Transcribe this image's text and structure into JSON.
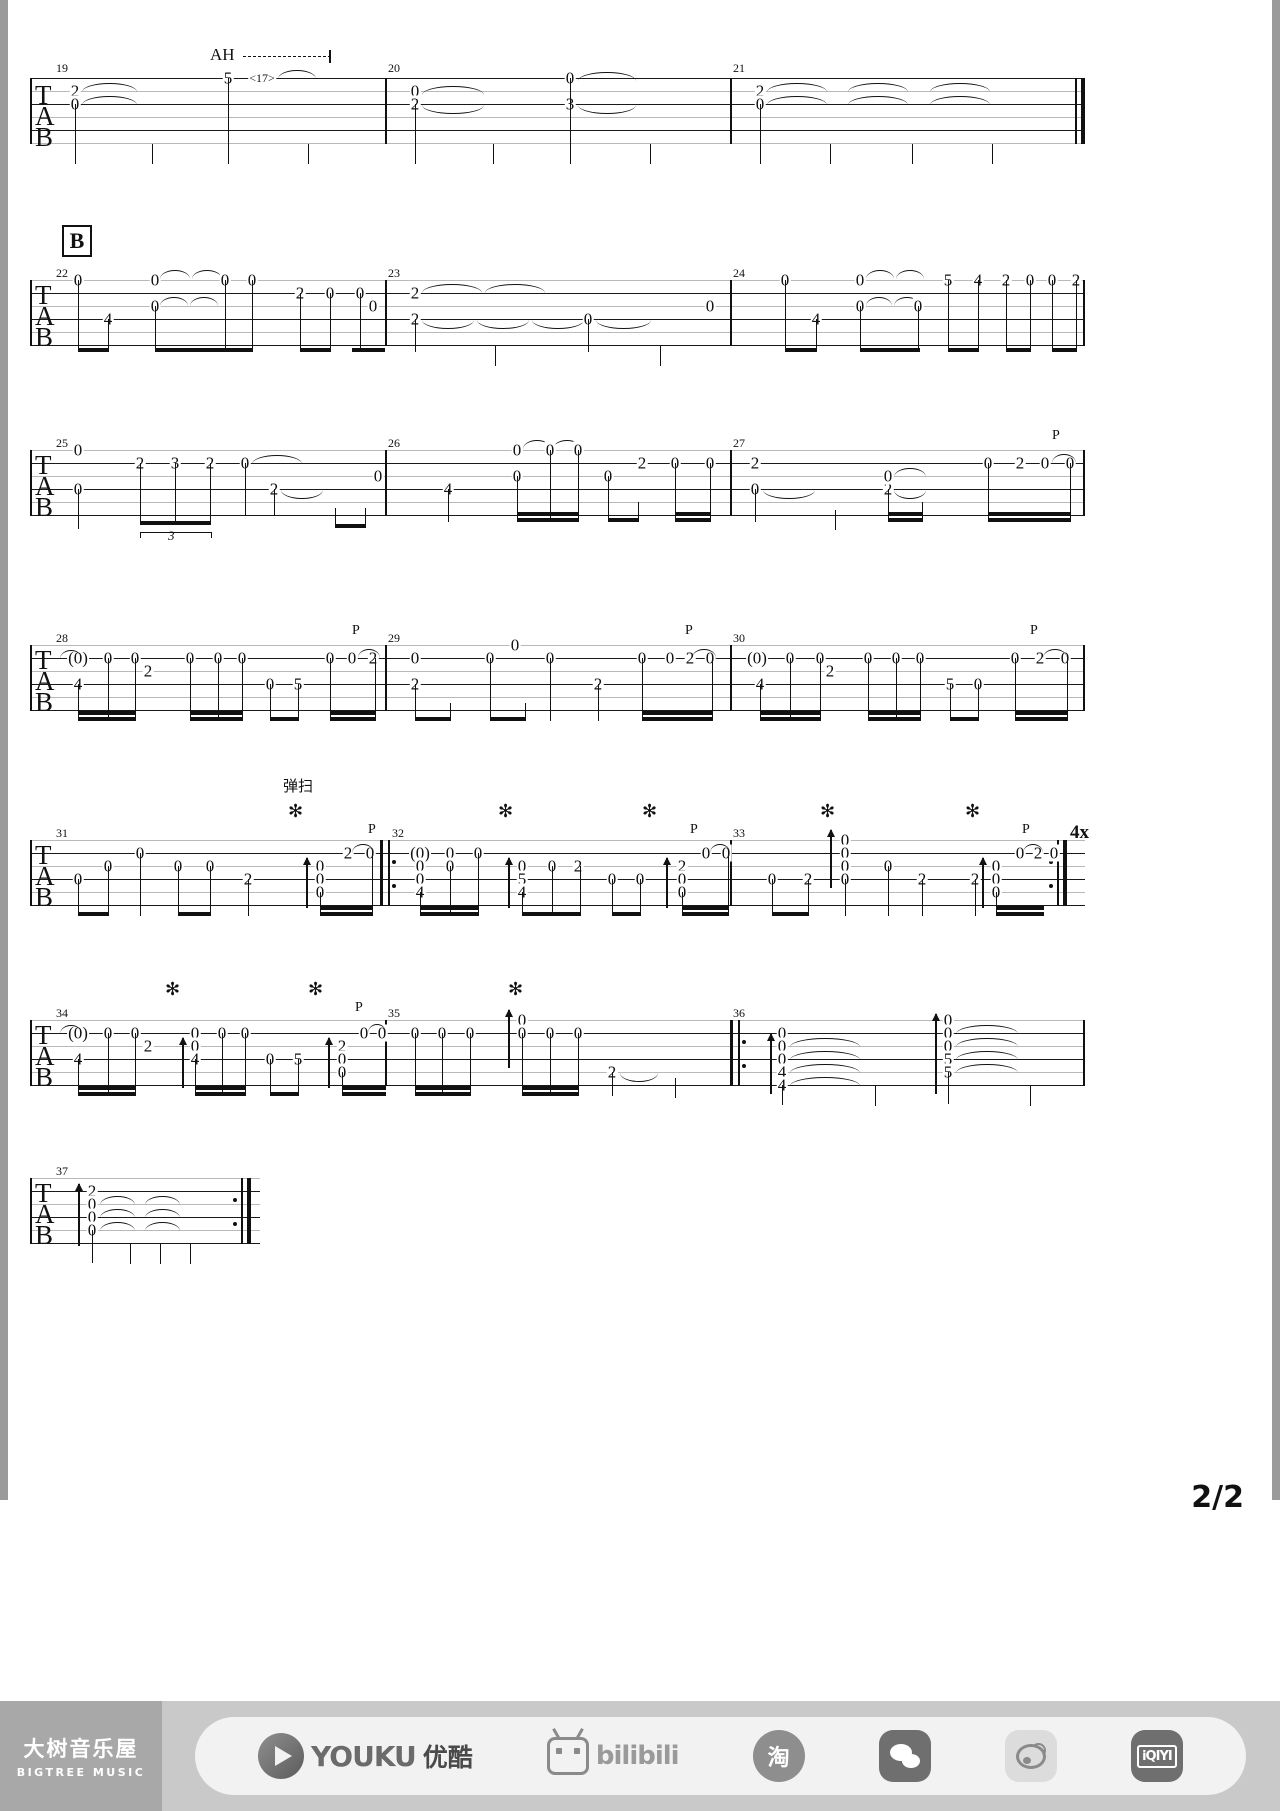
{
  "document": {
    "type": "guitar-tablature",
    "page_label": "2/2",
    "string_labels": [
      "T",
      "A",
      "B"
    ],
    "section_marker": "B",
    "annotations": {
      "artificial_harmonic": "AH",
      "strum_cn": "弹扫",
      "pull_off": "P",
      "repeat_times": "4x",
      "triplet": "3",
      "harmonic_fret": "<17>",
      "asterisk": "✻"
    }
  },
  "systems": [
    {
      "id": "system-1",
      "measures": [
        "19",
        "20",
        "21"
      ],
      "notes_m19": [
        "2",
        "0",
        "5",
        "<17>"
      ],
      "notes_m20": [
        "0",
        "2",
        "0",
        "3"
      ],
      "notes_m21": [
        "2",
        "0"
      ]
    },
    {
      "id": "system-2",
      "measures": [
        "22",
        "23",
        "24"
      ],
      "notes_m22": [
        "0",
        "4",
        "0",
        "0",
        "0",
        "0",
        "2",
        "0",
        "0",
        "0"
      ],
      "notes_m23": [
        "2",
        "0",
        "0",
        "2",
        "0"
      ],
      "notes_m24": [
        "0",
        "4",
        "0",
        "0",
        "0",
        "5",
        "4",
        "2",
        "0",
        "0",
        "2"
      ]
    },
    {
      "id": "system-3",
      "measures": [
        "25",
        "26",
        "27"
      ],
      "notes_m25": [
        "0",
        "0",
        "2",
        "3",
        "2",
        "0",
        "2",
        "0"
      ],
      "notes_m26": [
        "4",
        "0",
        "0",
        "0",
        "0",
        "0",
        "2",
        "0",
        "0"
      ],
      "notes_m27": [
        "2",
        "0",
        "2",
        "0",
        "0",
        "2",
        "0"
      ]
    },
    {
      "id": "system-4",
      "measures": [
        "28",
        "29",
        "30"
      ],
      "notes_m28": [
        "(0)",
        "4",
        "0",
        "0",
        "2",
        "0",
        "0",
        "0",
        "0",
        "0",
        "5",
        "0",
        "0",
        "2",
        "0"
      ],
      "notes_m29": [
        "0",
        "0",
        "0",
        "2",
        "0",
        "0",
        "2",
        "0",
        "0",
        "2"
      ],
      "notes_m30": [
        "(0)",
        "4",
        "0",
        "0",
        "2",
        "0",
        "0",
        "0",
        "5",
        "0",
        "2",
        "0"
      ]
    },
    {
      "id": "system-5",
      "measures": [
        "31",
        "32",
        "33"
      ],
      "notes_m31": [
        "0",
        "0",
        "0",
        "0",
        "2",
        "0",
        "2",
        "0",
        "0",
        "0"
      ],
      "notes_m32": [
        "(0)",
        "0",
        "0",
        "4",
        "0",
        "0",
        "0",
        "4",
        "0",
        "5",
        "0",
        "2",
        "0",
        "0",
        "2",
        "0"
      ],
      "notes_m33": [
        "0",
        "0",
        "0",
        "0",
        "0",
        "2",
        "2",
        "0",
        "0",
        "0",
        "2",
        "0"
      ]
    },
    {
      "id": "system-6",
      "measures": [
        "34",
        "35",
        "36"
      ],
      "notes_m34": [
        "(0)",
        "4",
        "0",
        "0",
        "2",
        "0",
        "0",
        "4",
        "0",
        "5",
        "0",
        "0",
        "0",
        "2",
        "0"
      ],
      "notes_m35": [
        "0",
        "0",
        "0",
        "0",
        "0",
        "0",
        "2"
      ],
      "notes_m36": [
        "0",
        "0",
        "0",
        "4",
        "4",
        "0",
        "0",
        "0",
        "5",
        "5"
      ]
    },
    {
      "id": "system-7",
      "measures": [
        "37"
      ],
      "notes_m37": [
        "2",
        "0",
        "0",
        "0"
      ]
    }
  ],
  "footer": {
    "brand_cn": "大树音乐屋",
    "brand_en": "BIGTREE MUSIC",
    "logos": [
      {
        "name": "youku",
        "text": "YOUKU",
        "cn": "优酷"
      },
      {
        "name": "bilibili",
        "text": "bilibili"
      },
      {
        "name": "taobao",
        "text": "淘"
      },
      {
        "name": "wechat",
        "text": ""
      },
      {
        "name": "weibo",
        "text": ""
      },
      {
        "name": "iqiyi",
        "text": "iQIYI"
      }
    ]
  }
}
